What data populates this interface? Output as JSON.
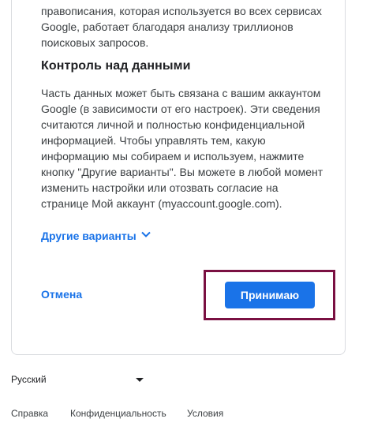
{
  "intro_text": "правописания, которая используется во всех сервисах\nGoogle, работает благодаря анализу триллионов\nпоисковых запросов.",
  "section": {
    "title": "Контроль над данными",
    "body": "Часть данных может быть связана с вашим аккаунтом\nGoogle (в зависимости от его настроек). Эти сведения\nсчитаются личной и полностью конфиденциальной\nинформацией. Чтобы управлять тем, какую\nинформацию мы собираем и используем, нажмите\nкнопку \"Другие варианты\". Вы можете в любой момент\nизменить настройки или отозвать согласие на\nстранице Мой аккаунт (myaccount.google.com)."
  },
  "more_options": {
    "label": "Другие варианты",
    "icon": "chevron-down-icon"
  },
  "actions": {
    "cancel_label": "Отмена",
    "accept_label": "Принимаю"
  },
  "colors": {
    "accent": "#1a73e8",
    "highlight_border": "#7a1042"
  },
  "footer": {
    "language": "Русский",
    "links": [
      "Справка",
      "Конфиденциальность",
      "Условия"
    ]
  }
}
